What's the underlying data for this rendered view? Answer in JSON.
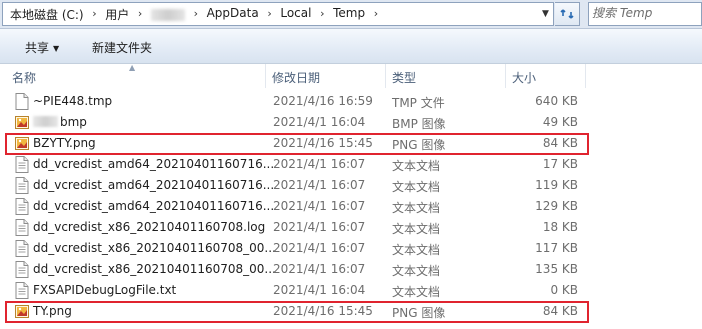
{
  "address": {
    "crumbs": [
      "本地磁盘 (C:)",
      "用户",
      "AppData",
      "Local",
      "Temp"
    ],
    "separator": "›"
  },
  "search": {
    "placeholder": "搜索 Temp"
  },
  "toolbar": {
    "share_label": "共享",
    "new_folder_label": "新建文件夹"
  },
  "columns": {
    "name": "名称",
    "date": "修改日期",
    "type": "类型",
    "size": "大小"
  },
  "files": [
    {
      "name": "~PIE448.tmp",
      "date": "2021/4/16 16:59",
      "type": "TMP 文件",
      "size": "640 KB",
      "icon": "file-icon",
      "highlighted": false
    },
    {
      "name": "bmp",
      "date": "2021/4/1 16:04",
      "type": "BMP 图像",
      "size": "49 KB",
      "icon": "image-file-icon",
      "highlighted": false,
      "name_prefix_obscured": true
    },
    {
      "name": "BZYTY.png",
      "date": "2021/4/16 15:45",
      "type": "PNG 图像",
      "size": "84 KB",
      "icon": "image-file-icon",
      "highlighted": true
    },
    {
      "name": "dd_vcredist_amd64_20210401160716...",
      "date": "2021/4/1 16:07",
      "type": "文本文档",
      "size": "17 KB",
      "icon": "text-file-icon",
      "highlighted": false
    },
    {
      "name": "dd_vcredist_amd64_20210401160716...",
      "date": "2021/4/1 16:07",
      "type": "文本文档",
      "size": "119 KB",
      "icon": "text-file-icon",
      "highlighted": false
    },
    {
      "name": "dd_vcredist_amd64_20210401160716...",
      "date": "2021/4/1 16:07",
      "type": "文本文档",
      "size": "129 KB",
      "icon": "text-file-icon",
      "highlighted": false
    },
    {
      "name": "dd_vcredist_x86_20210401160708.log",
      "date": "2021/4/1 16:07",
      "type": "文本文档",
      "size": "18 KB",
      "icon": "text-file-icon",
      "highlighted": false
    },
    {
      "name": "dd_vcredist_x86_20210401160708_00...",
      "date": "2021/4/1 16:07",
      "type": "文本文档",
      "size": "117 KB",
      "icon": "text-file-icon",
      "highlighted": false
    },
    {
      "name": "dd_vcredist_x86_20210401160708_00...",
      "date": "2021/4/1 16:07",
      "type": "文本文档",
      "size": "135 KB",
      "icon": "text-file-icon",
      "highlighted": false
    },
    {
      "name": "FXSAPIDebugLogFile.txt",
      "date": "2021/4/1 16:04",
      "type": "文本文档",
      "size": "0 KB",
      "icon": "text-file-icon",
      "highlighted": false
    },
    {
      "name": "TY.png",
      "date": "2021/4/16 15:45",
      "type": "PNG 图像",
      "size": "84 KB",
      "icon": "image-file-icon",
      "highlighted": true
    }
  ],
  "colors": {
    "highlight_border": "#e0242f",
    "header_text": "#4c607a",
    "meta_text": "#6d6d6d"
  }
}
